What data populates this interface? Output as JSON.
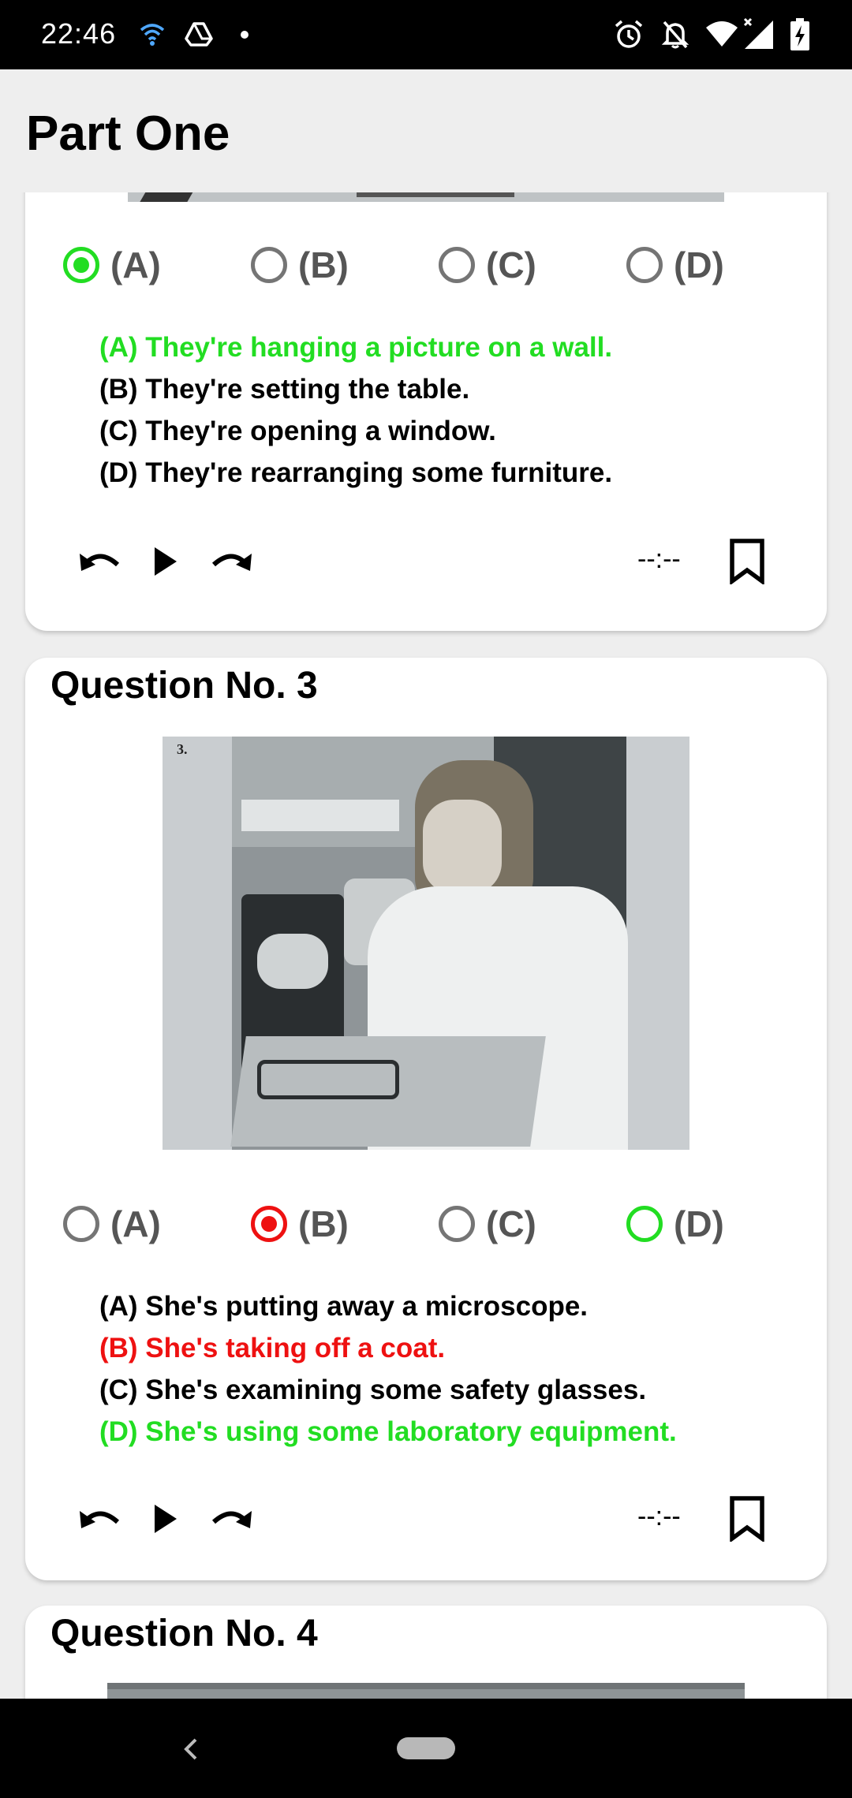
{
  "status_bar": {
    "time": "22:46",
    "left_icons": [
      "wifi-signal-icon",
      "drive-icon",
      "dot-icon"
    ],
    "right_icons": [
      "alarm-icon",
      "notifications-off-icon",
      "wifi-icon",
      "signal-icon",
      "battery-charging-icon"
    ]
  },
  "app_bar": {
    "title": "Part One"
  },
  "questions": [
    {
      "title": "",
      "options": [
        "(A)",
        "(B)",
        "(C)",
        "(D)"
      ],
      "selected": "(A)",
      "correct": "(A)",
      "answers": [
        "(A) They're hanging a picture on a wall.",
        "(B) They're setting the table.",
        "(C) They're opening a window.",
        "(D) They're rearranging some furniture."
      ],
      "time": "--:--"
    },
    {
      "title": "Question No. 3",
      "image_number": "3.",
      "options": [
        "(A)",
        "(B)",
        "(C)",
        "(D)"
      ],
      "selected": "(B)",
      "correct": "(D)",
      "answers": [
        "(A) She's putting away a microscope.",
        "(B) She's taking off a coat.",
        "(C) She's examining some safety glasses.",
        "(D) She's using some laboratory equipment."
      ],
      "time": "--:--"
    },
    {
      "title": "Question No. 4"
    }
  ],
  "controls": {
    "icons": [
      "replay-icon",
      "play-icon",
      "forward-icon",
      "bookmark-icon"
    ]
  },
  "colors": {
    "correct": "#22dd22",
    "wrong": "#ee1111",
    "card_background": "#ffffff",
    "page_background": "#eeeeee"
  },
  "nav_bar": {
    "icons": [
      "back-icon",
      "home-pill-icon"
    ]
  }
}
